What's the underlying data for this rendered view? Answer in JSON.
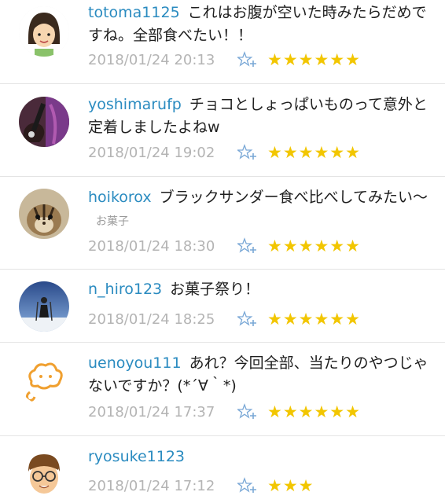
{
  "comments": [
    {
      "user": "totoma1125",
      "text": "これはお腹が空いた時みたらだめですね。全部食べたい！！",
      "tag": "",
      "date": "2018/01/24 20:13",
      "stars": "★★★★★★",
      "rating": 6,
      "avatar": "cartoon-girl-avatar"
    },
    {
      "user": "yoshimarufp",
      "text": "チョコとしょっぱいものって意外と定着しましたよねw",
      "tag": "",
      "date": "2018/01/24 19:02",
      "stars": "★★★★★★",
      "rating": 6,
      "avatar": "guitar-photo-avatar"
    },
    {
      "user": "hoikorox",
      "text": "ブラックサンダー食べ比べしてみたい～",
      "tag": "お菓子",
      "date": "2018/01/24 18:30",
      "stars": "★★★★★★",
      "rating": 6,
      "avatar": "chipmunk-photo-avatar"
    },
    {
      "user": "n_hiro123",
      "text": "お菓子祭り！",
      "tag": "",
      "date": "2018/01/24 18:25",
      "stars": "★★★★★★",
      "rating": 6,
      "avatar": "skier-photo-avatar"
    },
    {
      "user": "uenoyou111",
      "text": "あれ？今回全部、当たりのやつじゃないですか？(*´∀｀*)",
      "tag": "",
      "date": "2018/01/24 17:37",
      "stars": "★★★★★★",
      "rating": 6,
      "avatar": "cloud-character-avatar"
    },
    {
      "user": "ryosuke1123",
      "text": "",
      "tag": "",
      "date": "2018/01/24 17:12",
      "stars": "★★★",
      "rating": 3,
      "avatar": "cartoon-boy-glasses-avatar"
    }
  ],
  "colors": {
    "username": "#2a8bc0",
    "star": "#f2c600",
    "date": "#b4b4b4",
    "add_star_icon": "#7aa8d6"
  },
  "icons": {
    "add_star": "star-plus-icon"
  }
}
